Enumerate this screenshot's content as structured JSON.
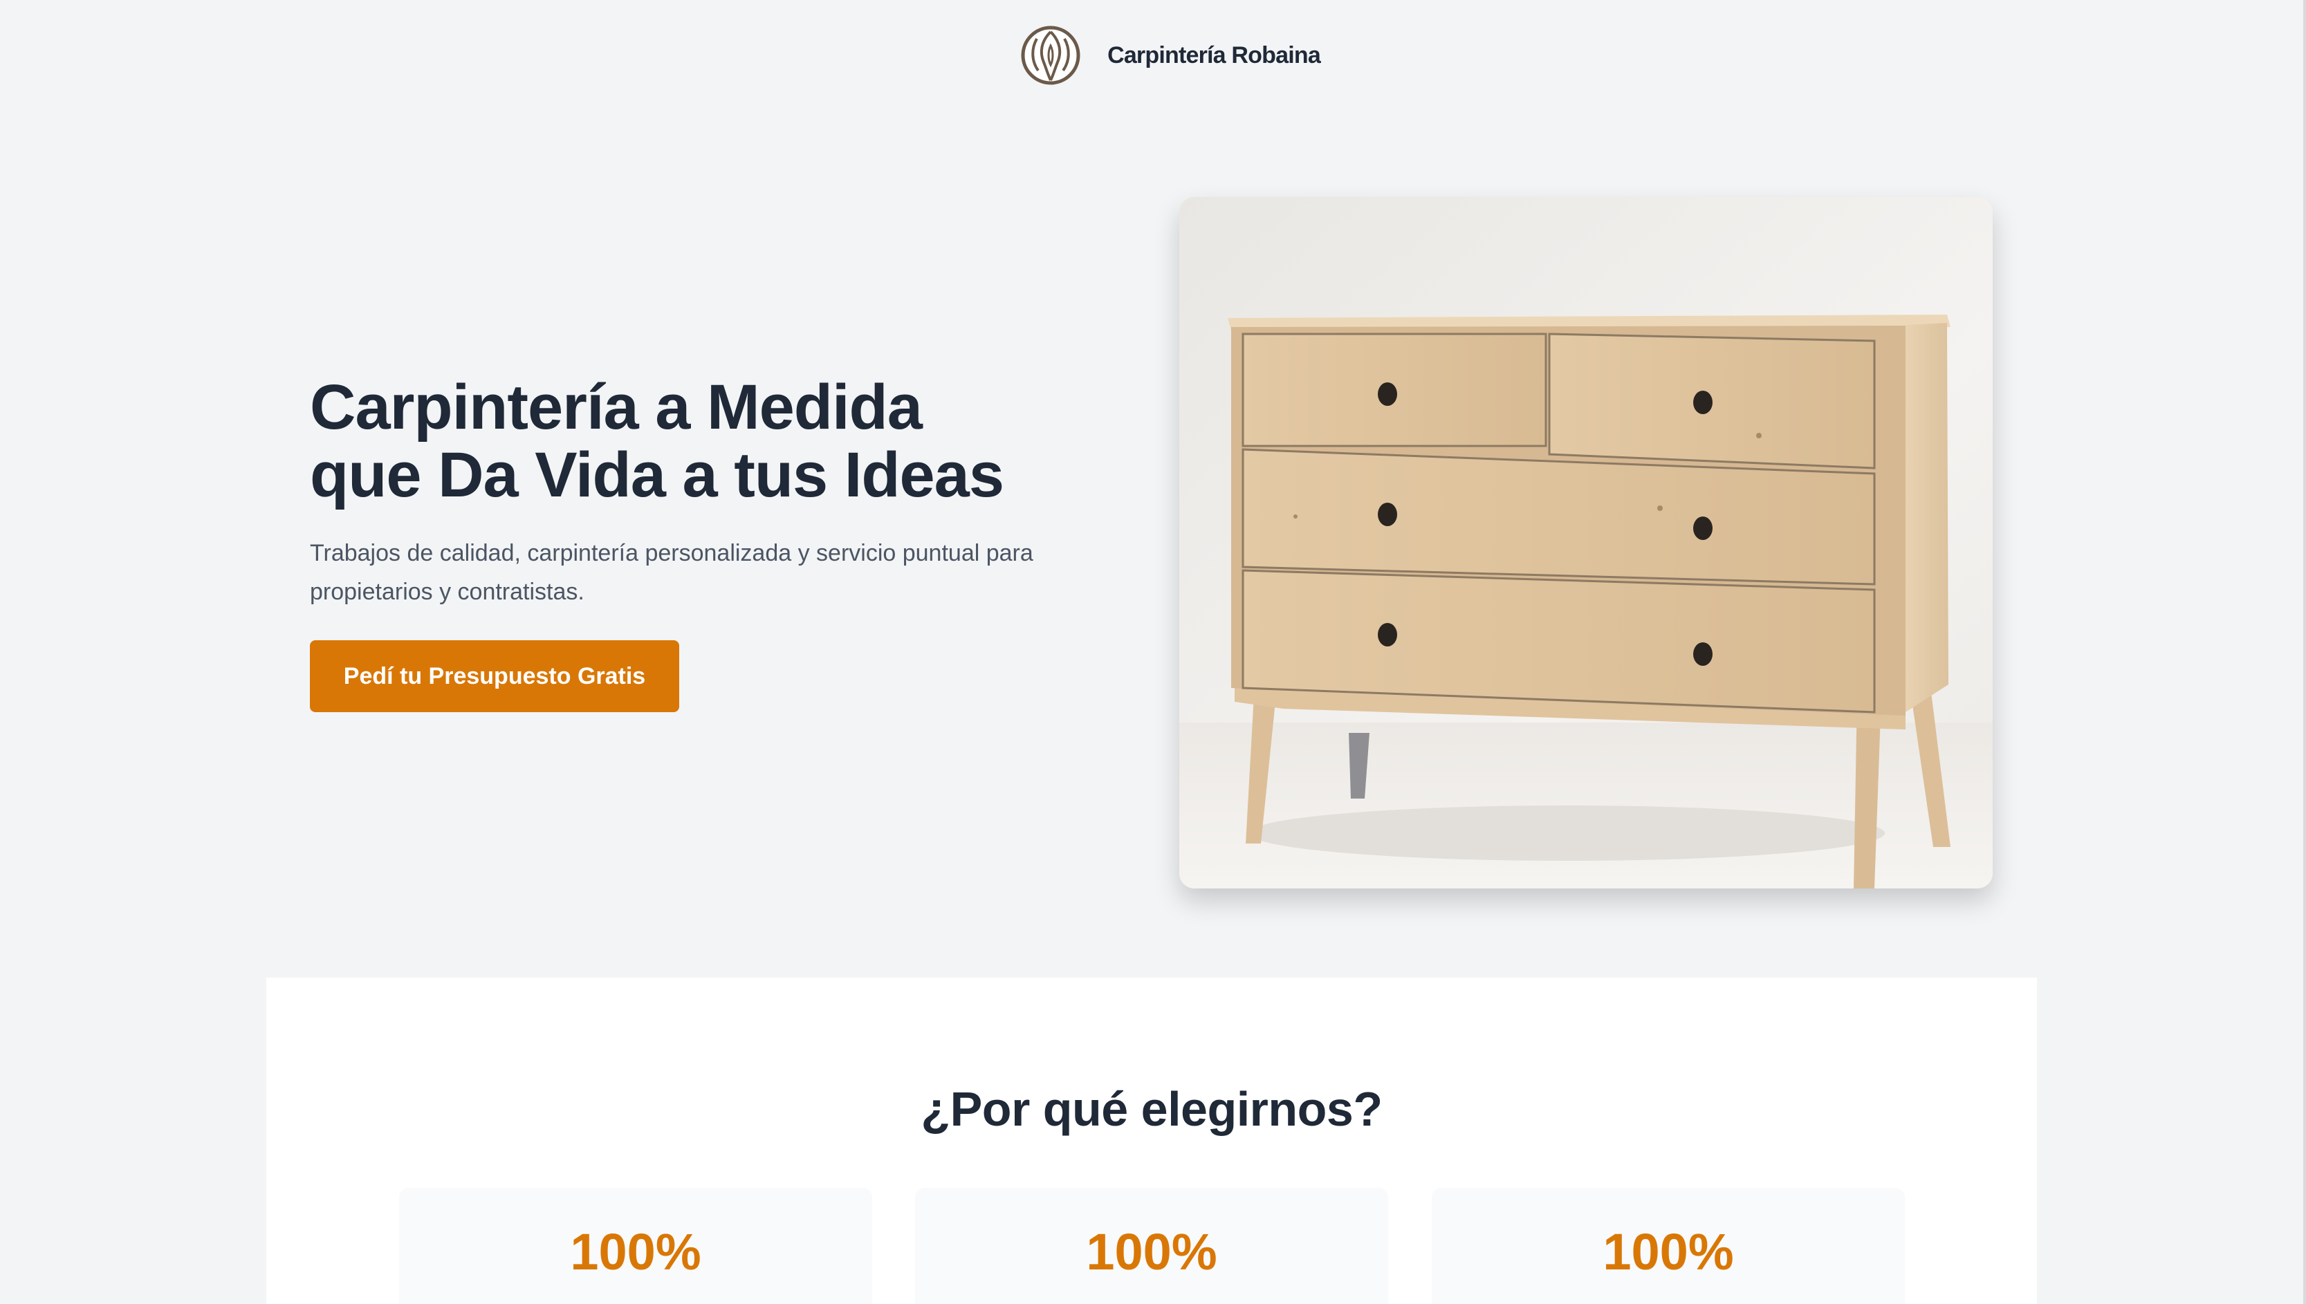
{
  "brand": {
    "name": "Carpintería Robaina",
    "logo_icon": "wood-grain-icon"
  },
  "hero": {
    "title": "Carpintería a Medida\nque Da Vida a tus Ideas",
    "subtitle": "Trabajos de calidad, carpintería personalizada y servicio puntual para propietarios y contratistas.",
    "cta_label": "Pedí tu Presupuesto Gratis",
    "image_subject": "wooden chest of drawers"
  },
  "why": {
    "title": "¿Por qué elegirnos?",
    "stats": [
      {
        "value": "100%"
      },
      {
        "value": "100%"
      },
      {
        "value": "100%"
      }
    ]
  },
  "colors": {
    "accent": "#d97706",
    "heading": "#1f2937",
    "body_text": "#4b5563",
    "page_bg": "#f3f4f6",
    "card_bg": "#f9fafb"
  }
}
